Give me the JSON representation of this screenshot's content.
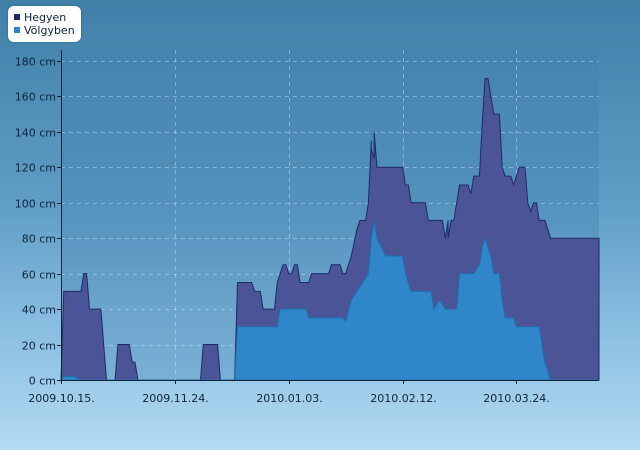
{
  "chart_data": {
    "type": "area",
    "title": "",
    "xlabel": "",
    "ylabel": "",
    "x_tick_labels": [
      "2009.10.15.",
      "2009.11.24.",
      "2010.01.03.",
      "2010.02.12.",
      "2010.03.24."
    ],
    "x_start": "2009-10-15",
    "x_end": "2010-04-22",
    "y_unit": "cm",
    "ylim": [
      0,
      185
    ],
    "y_ticks": [
      0,
      20,
      40,
      60,
      80,
      100,
      120,
      140,
      160,
      180
    ],
    "y_tick_labels": [
      "0 cm",
      "20 cm",
      "40 cm",
      "60 cm",
      "80 cm",
      "100 cm",
      "120 cm",
      "140 cm",
      "160 cm",
      "180 cm"
    ],
    "grid": true,
    "legend_position": "top-left",
    "series": [
      {
        "name": "Hegyen",
        "color": "#4a5496",
        "edge_color": "#1e2a66",
        "points": [
          [
            "2009-10-15",
            0
          ],
          [
            "2009-10-16",
            50
          ],
          [
            "2009-10-22",
            50
          ],
          [
            "2009-10-23",
            60
          ],
          [
            "2009-10-24",
            60
          ],
          [
            "2009-10-25",
            40
          ],
          [
            "2009-10-29",
            40
          ],
          [
            "2009-10-30",
            20
          ],
          [
            "2009-10-31",
            0
          ],
          [
            "2009-11-03",
            0
          ],
          [
            "2009-11-04",
            20
          ],
          [
            "2009-11-08",
            20
          ],
          [
            "2009-11-09",
            10
          ],
          [
            "2009-11-10",
            10
          ],
          [
            "2009-11-11",
            0
          ],
          [
            "2009-12-03",
            0
          ],
          [
            "2009-12-04",
            20
          ],
          [
            "2009-12-09",
            20
          ],
          [
            "2009-12-10",
            0
          ],
          [
            "2009-12-15",
            0
          ],
          [
            "2009-12-16",
            55
          ],
          [
            "2009-12-21",
            55
          ],
          [
            "2009-12-22",
            50
          ],
          [
            "2009-12-24",
            50
          ],
          [
            "2009-12-25",
            40
          ],
          [
            "2009-12-29",
            40
          ],
          [
            "2009-12-30",
            55
          ],
          [
            "2010-01-01",
            65
          ],
          [
            "2010-01-02",
            65
          ],
          [
            "2010-01-03",
            60
          ],
          [
            "2010-01-04",
            60
          ],
          [
            "2010-01-05",
            65
          ],
          [
            "2010-01-06",
            65
          ],
          [
            "2010-01-07",
            55
          ],
          [
            "2010-01-10",
            55
          ],
          [
            "2010-01-11",
            60
          ],
          [
            "2010-01-17",
            60
          ],
          [
            "2010-01-18",
            65
          ],
          [
            "2010-01-21",
            65
          ],
          [
            "2010-01-22",
            60
          ],
          [
            "2010-01-23",
            60
          ],
          [
            "2010-01-25",
            70
          ],
          [
            "2010-01-27",
            85
          ],
          [
            "2010-01-28",
            90
          ],
          [
            "2010-01-30",
            90
          ],
          [
            "2010-01-31",
            100
          ],
          [
            "2010-02-01",
            135
          ],
          [
            "2010-02-01",
            130
          ],
          [
            "2010-02-02",
            125
          ],
          [
            "2010-02-02",
            140
          ],
          [
            "2010-02-03",
            120
          ],
          [
            "2010-02-12",
            120
          ],
          [
            "2010-02-13",
            110
          ],
          [
            "2010-02-14",
            110
          ],
          [
            "2010-02-15",
            100
          ],
          [
            "2010-02-20",
            100
          ],
          [
            "2010-02-21",
            90
          ],
          [
            "2010-02-26",
            90
          ],
          [
            "2010-02-27",
            80
          ],
          [
            "2010-02-28",
            90
          ],
          [
            "2010-02-28",
            80
          ],
          [
            "2010-03-01",
            90
          ],
          [
            "2010-03-02",
            90
          ],
          [
            "2010-03-03",
            100
          ],
          [
            "2010-03-04",
            110
          ],
          [
            "2010-03-07",
            110
          ],
          [
            "2010-03-08",
            105
          ],
          [
            "2010-03-09",
            115
          ],
          [
            "2010-03-11",
            115
          ],
          [
            "2010-03-12",
            145
          ],
          [
            "2010-03-13",
            170
          ],
          [
            "2010-03-14",
            170
          ],
          [
            "2010-03-15",
            160
          ],
          [
            "2010-03-16",
            150
          ],
          [
            "2010-03-18",
            150
          ],
          [
            "2010-03-19",
            120
          ],
          [
            "2010-03-20",
            115
          ],
          [
            "2010-03-22",
            115
          ],
          [
            "2010-03-23",
            110
          ],
          [
            "2010-03-24",
            115
          ],
          [
            "2010-03-25",
            120
          ],
          [
            "2010-03-27",
            120
          ],
          [
            "2010-03-28",
            100
          ],
          [
            "2010-03-29",
            95
          ],
          [
            "2010-03-30",
            100
          ],
          [
            "2010-03-31",
            100
          ],
          [
            "2010-04-01",
            90
          ],
          [
            "2010-04-03",
            90
          ],
          [
            "2010-04-05",
            80
          ],
          [
            "2010-04-22",
            80
          ]
        ]
      },
      {
        "name": "Völgyben",
        "color": "#2f86c8",
        "edge_color": "#1e6fae",
        "points": [
          [
            "2009-10-15",
            0
          ],
          [
            "2009-10-16",
            2
          ],
          [
            "2009-10-20",
            2
          ],
          [
            "2009-10-22",
            0
          ],
          [
            "2009-12-15",
            0
          ],
          [
            "2009-12-16",
            30
          ],
          [
            "2009-12-30",
            30
          ],
          [
            "2009-12-31",
            40
          ],
          [
            "2010-01-09",
            40
          ],
          [
            "2010-01-10",
            35
          ],
          [
            "2010-01-22",
            35
          ],
          [
            "2010-01-23",
            33
          ],
          [
            "2010-01-25",
            45
          ],
          [
            "2010-01-27",
            50
          ],
          [
            "2010-01-29",
            55
          ],
          [
            "2010-01-31",
            60
          ],
          [
            "2010-02-01",
            80
          ],
          [
            "2010-02-02",
            90
          ],
          [
            "2010-02-03",
            80
          ],
          [
            "2010-02-06",
            70
          ],
          [
            "2010-02-12",
            70
          ],
          [
            "2010-02-13",
            60
          ],
          [
            "2010-02-15",
            50
          ],
          [
            "2010-02-22",
            50
          ],
          [
            "2010-02-23",
            40
          ],
          [
            "2010-02-25",
            45
          ],
          [
            "2010-02-27",
            40
          ],
          [
            "2010-03-03",
            40
          ],
          [
            "2010-03-04",
            60
          ],
          [
            "2010-03-09",
            60
          ],
          [
            "2010-03-11",
            65
          ],
          [
            "2010-03-12",
            75
          ],
          [
            "2010-03-13",
            80
          ],
          [
            "2010-03-15",
            70
          ],
          [
            "2010-03-16",
            60
          ],
          [
            "2010-03-18",
            60
          ],
          [
            "2010-03-19",
            45
          ],
          [
            "2010-03-20",
            35
          ],
          [
            "2010-03-23",
            35
          ],
          [
            "2010-03-24",
            30
          ],
          [
            "2010-04-01",
            30
          ],
          [
            "2010-04-02",
            20
          ],
          [
            "2010-04-03",
            10
          ],
          [
            "2010-04-05",
            0
          ],
          [
            "2010-04-22",
            0
          ]
        ]
      }
    ]
  }
}
